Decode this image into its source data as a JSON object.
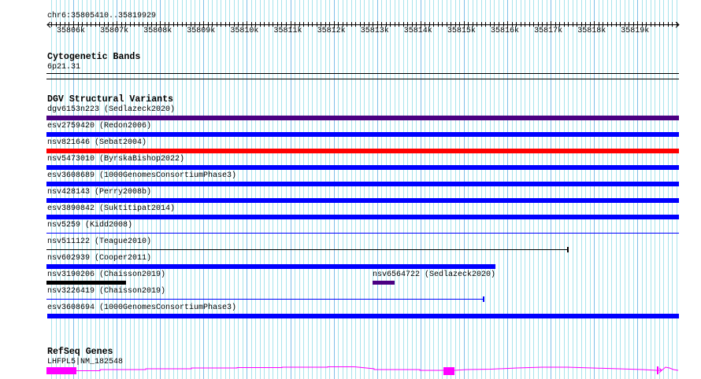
{
  "location": {
    "label": "chr6:35805410..35819929",
    "start": 35805410,
    "end": 35819929
  },
  "ruler": {
    "tick_labels": [
      "35806k",
      "35807k",
      "35808k",
      "35809k",
      "35810k",
      "35811k",
      "35812k",
      "35813k",
      "35814k",
      "35815k",
      "35816k",
      "35817k",
      "35818k",
      "35819k"
    ]
  },
  "cytobands": {
    "title": "Cytogenetic Bands",
    "band": "6p21.31"
  },
  "dgv": {
    "title": "DGV Structural Variants",
    "features": [
      {
        "label": "dgv6153n223 (Sedlazeck2020)",
        "color": "#4b0082"
      },
      {
        "label": "esv2759420 (Redon2006)",
        "color": "#0000ff"
      },
      {
        "label": "nsv821646 (Sebat2004)",
        "color": "#ff0000"
      },
      {
        "label": "nsv5473010 (ByrskaBishop2022)",
        "color": "#0000ff"
      },
      {
        "label": "esv3608689 (1000GenomesConsortiumPhase3)",
        "color": "#0000ff"
      },
      {
        "label": "nsv428143 (Perry2008b)",
        "color": "#0000ff"
      },
      {
        "label": "esv3890842 (Suktitipat2014)",
        "color": "#0000ff"
      },
      {
        "label": "nsv5259 (Kidd2008)",
        "color": "#0000ff"
      },
      {
        "label": "nsv511122 (Teague2010)",
        "color": "#000000"
      },
      {
        "label": "nsv602939 (Cooper2011)",
        "color": "#0000ff"
      },
      {
        "label": "nsv3190206 (Chaisson2019)",
        "color": "#000000"
      },
      {
        "label": "nsv6564722 (Sedlazeck2020)",
        "color": "#4b0082"
      },
      {
        "label": "nsv3226419 (Chaisson2019)",
        "color": "#0000ff"
      },
      {
        "label": "esv3608694 (1000GenomesConsortiumPhase3)",
        "color": "#0000ff"
      }
    ]
  },
  "refseq": {
    "title": "RefSeq Genes",
    "gene_label": "LHFPL5|NM_182548",
    "color": "#ff00ff"
  }
}
